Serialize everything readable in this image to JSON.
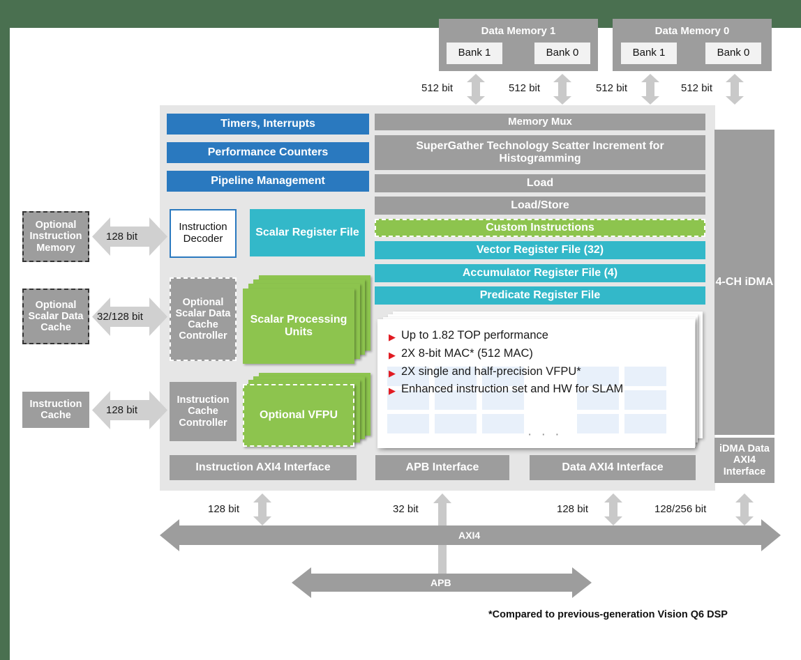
{
  "colors": {
    "background": "#4a7050",
    "panel": "#ffffff",
    "core_panel": "#e6e6e6",
    "gray": "#9d9d9d",
    "blue": "#2a79bf",
    "teal": "#33b8c9",
    "green": "#8dc44e",
    "bullet_marker": "#e11b22",
    "grid_cell": "#e8f0fa"
  },
  "memories": [
    {
      "title": "Data Memory 1",
      "banks": [
        "Bank 1",
        "Bank 0"
      ],
      "bit_labels": [
        "512 bit",
        "512 bit"
      ]
    },
    {
      "title": "Data Memory 0",
      "banks": [
        "Bank 1",
        "Bank 0"
      ],
      "bit_labels": [
        "512 bit",
        "512 bit"
      ]
    }
  ],
  "left_blocks": [
    {
      "label": "Optional Instruction Memory",
      "bit_label": "128 bit"
    },
    {
      "label": "Optional Scalar Data Cache",
      "bit_label": "32/128 bit"
    },
    {
      "label": "Instruction Cache",
      "bit_label": "128 bit"
    }
  ],
  "control_blocks": [
    {
      "label": "Timers, Interrupts"
    },
    {
      "label": "Performance Counters"
    },
    {
      "label": "Pipeline Management"
    }
  ],
  "decoder": {
    "label": "Instruction Decoder"
  },
  "scalar_register_file": {
    "label": "Scalar Register File"
  },
  "cache_controllers": [
    {
      "label": "Optional Scalar Data Cache Controller"
    },
    {
      "label": "Instruction Cache Controller"
    }
  ],
  "processing_stacks": [
    {
      "label": "Scalar Processing Units"
    },
    {
      "label": "Optional VFPU"
    }
  ],
  "pipeline_rows": [
    {
      "label": "Memory Mux",
      "style": "gray"
    },
    {
      "label": "SuperGather Technology Scatter Increment for Histogramming",
      "style": "gray"
    },
    {
      "label": "Load",
      "style": "gray"
    },
    {
      "label": "Load/Store",
      "style": "gray"
    },
    {
      "label": "Custom Instructions",
      "style": "green-dashed"
    },
    {
      "label": "Vector Register File (32)",
      "style": "teal"
    },
    {
      "label": "Accumulator Register File (4)",
      "style": "teal"
    },
    {
      "label": "Predicate Register File",
      "style": "teal"
    }
  ],
  "idma": {
    "label": "4-CH iDMA",
    "interface_label": "iDMA Data AXI4 Interface"
  },
  "callout": {
    "bullets": [
      "Up to 1.82 TOP performance",
      "2X 8-bit MAC* (512 MAC)",
      "2X single and half-precision VFPU*",
      "Enhanced instruction set and HW for SLAM"
    ],
    "ellipsis": "· · ·"
  },
  "interfaces": [
    {
      "label": "Instruction AXI4 Interface",
      "bit_label": "128 bit"
    },
    {
      "label": "APB Interface",
      "bit_label": "32 bit"
    },
    {
      "label": "Data AXI4 Interface",
      "bit_label": "128 bit"
    }
  ],
  "idma_bit_label": "128/256 bit",
  "buses": [
    {
      "label": "AXI4"
    },
    {
      "label": "APB"
    }
  ],
  "footnote": "*Compared to previous-generation Vision Q6 DSP"
}
